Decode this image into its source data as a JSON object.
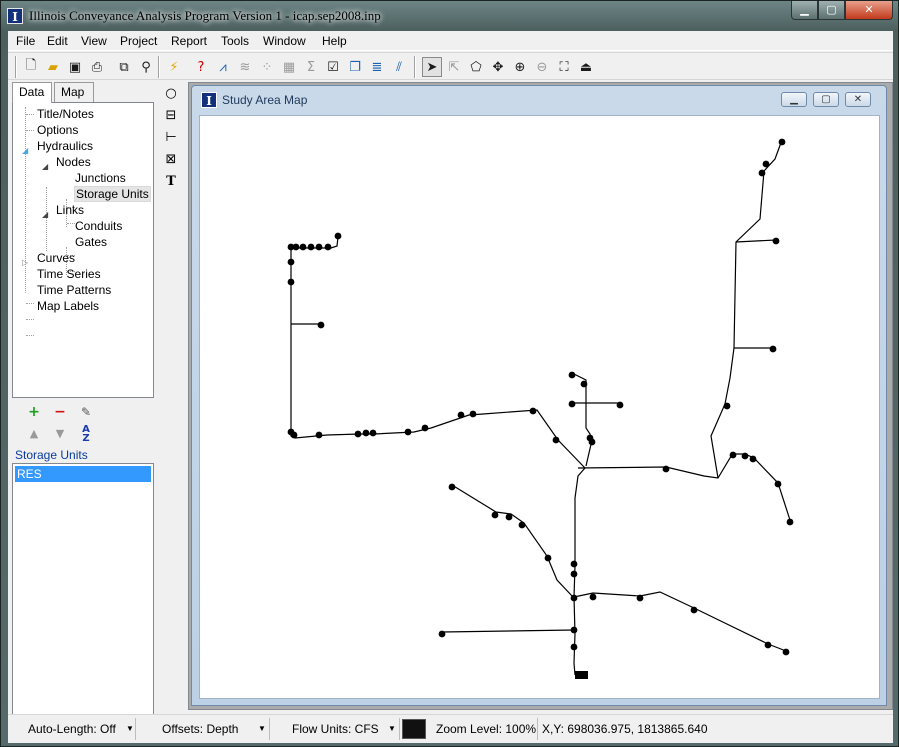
{
  "window": {
    "title": "Illinois Conveyance Analysis Program Version 1 - icap.sep2008.inp",
    "app_icon": "I",
    "controls": [
      "minimize-icon",
      "maximize-icon",
      "close-icon"
    ]
  },
  "menu": [
    "File",
    "Edit",
    "View",
    "Project",
    "Report",
    "Tools",
    "Window",
    "Help"
  ],
  "toolbar": {
    "icons": [
      "new-file-icon",
      "open-folder-icon",
      "save-icon",
      "print-icon",
      "copy-icon",
      "find-icon",
      "run-lightning-icon",
      "query-icon",
      "profile-icon",
      "timeseries-graph-icon",
      "scatter-plot-icon",
      "table-icon",
      "statistics-sigma-icon",
      "options-icon",
      "arrange-windows-icon",
      "legend-icon",
      "flow-icon",
      "select-arrow-icon",
      "vertex-select-icon",
      "region-select-icon",
      "pan-icon",
      "zoom-in-icon",
      "zoom-out-icon",
      "full-extent-icon",
      "measure-icon"
    ]
  },
  "left_panel": {
    "tabs": [
      "Data",
      "Map"
    ],
    "active_tab": "Data",
    "tree": [
      {
        "label": "Title/Notes",
        "level": 0
      },
      {
        "label": "Options",
        "level": 0
      },
      {
        "label": "Hydraulics",
        "level": 0,
        "expanded": true
      },
      {
        "label": "Nodes",
        "level": 1,
        "expanded": true
      },
      {
        "label": "Junctions",
        "level": 2
      },
      {
        "label": "Storage Units",
        "level": 2,
        "selected": true
      },
      {
        "label": "Links",
        "level": 1,
        "expanded": true
      },
      {
        "label": "Conduits",
        "level": 2
      },
      {
        "label": "Gates",
        "level": 2
      },
      {
        "label": "Curves",
        "level": 0,
        "expanded": false
      },
      {
        "label": "Time Series",
        "level": 0
      },
      {
        "label": "Time Patterns",
        "level": 0
      },
      {
        "label": "Map Labels",
        "level": 0
      }
    ],
    "object_tools": [
      "add-icon",
      "delete-icon",
      "edit-icon",
      "move-up-icon",
      "move-down-icon",
      "sort-az-icon"
    ],
    "object_list_label": "Storage Units",
    "objects": [
      "RES"
    ],
    "selected_object": "RES"
  },
  "map_tools": [
    "add-node-circle-icon",
    "add-storage-icon",
    "add-link-icon",
    "add-gate-icon",
    "add-label-text-icon"
  ],
  "map_window": {
    "title": "Study Area Map",
    "icon": "I"
  },
  "status_bar": {
    "auto_length": "Auto-Length: Off",
    "offsets": "Offsets: Depth",
    "flow_units": "Flow Units: CFS",
    "zoom_level": "Zoom Level: 100%",
    "xy": "X,Y: 698036.975, 1813865.640"
  }
}
